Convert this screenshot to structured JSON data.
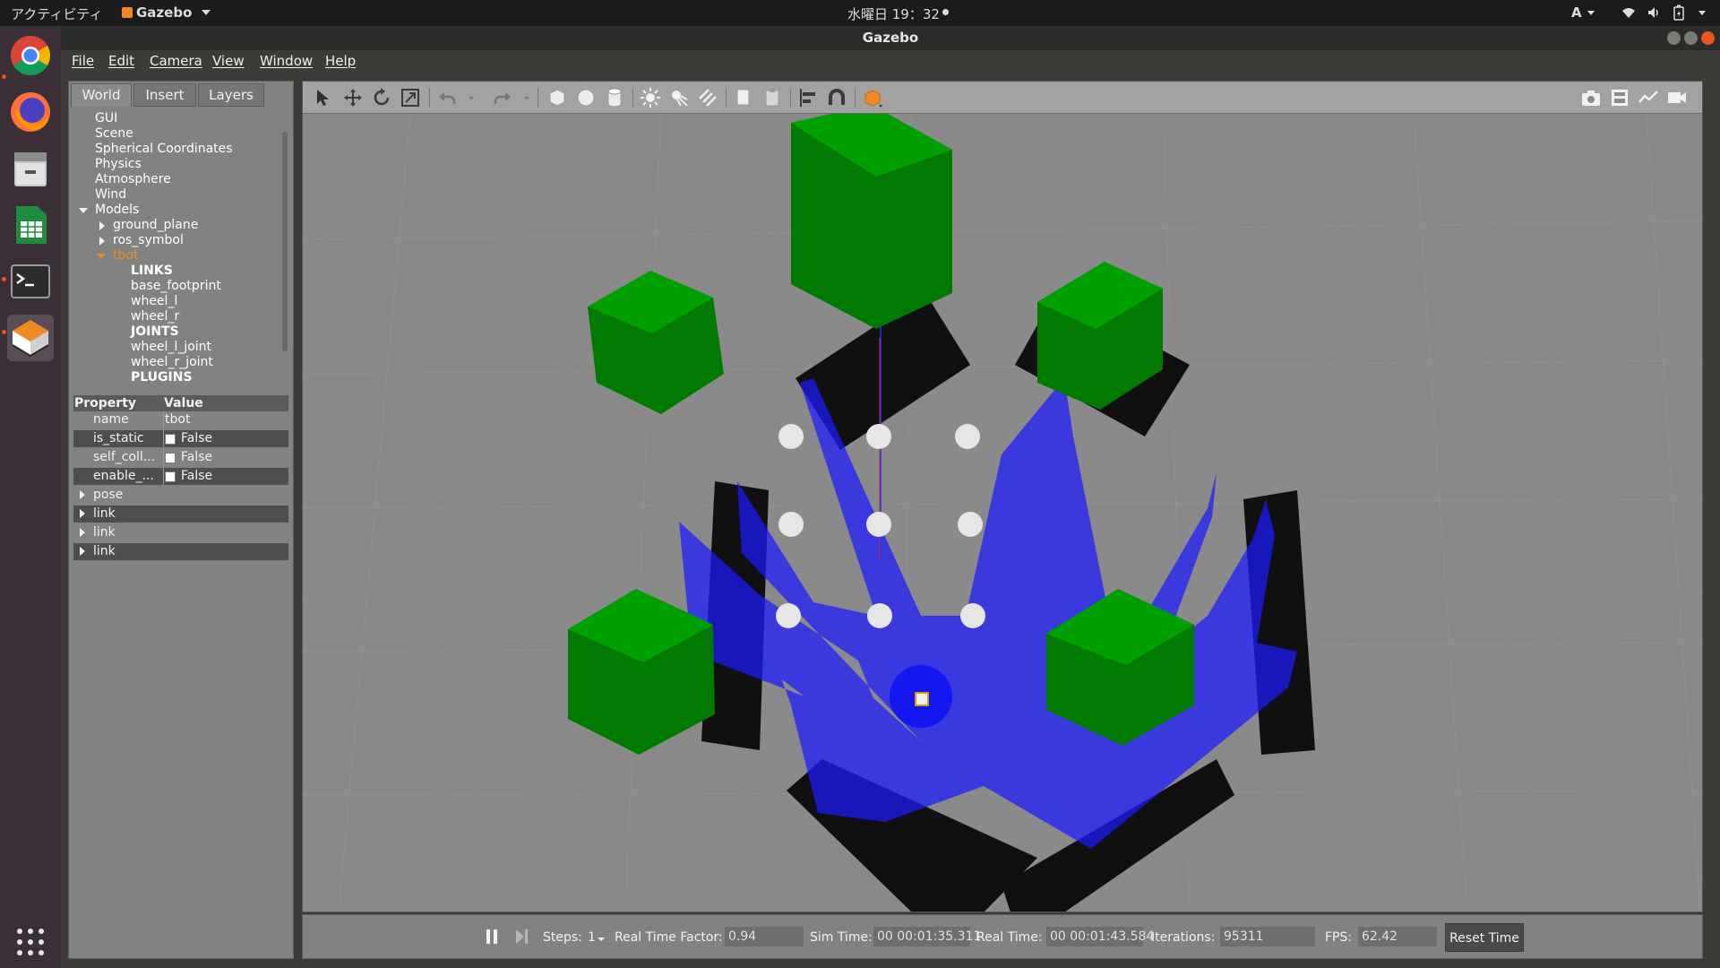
{
  "topbar": {
    "activities": "アクティビティ",
    "app_menu": "Gazebo",
    "clock": "水曜日 19：32",
    "input_method": "A"
  },
  "window": {
    "title": "Gazebo"
  },
  "menu": [
    "File",
    "Edit",
    "Camera",
    "View",
    "Window",
    "Help"
  ],
  "tabs": [
    "World",
    "Insert",
    "Layers"
  ],
  "tree": {
    "root_items": [
      "GUI",
      "Scene",
      "Spherical Coordinates",
      "Physics",
      "Atmosphere",
      "Wind"
    ],
    "models_label": "Models",
    "models": [
      "ground_plane",
      "ros_symbol"
    ],
    "selected_model": "tbot",
    "links_header": "LINKS",
    "links": [
      "base_footprint",
      "wheel_l",
      "wheel_r"
    ],
    "joints_header": "JOINTS",
    "joints": [
      "wheel_l_joint",
      "wheel_r_joint"
    ],
    "plugins_header": "PLUGINS"
  },
  "properties": {
    "header_property": "Property",
    "header_value": "Value",
    "name_key": "name",
    "name_value": "tbot",
    "is_static_key": "is_static",
    "is_static_value": "False",
    "self_coll_key": "self_coll...",
    "self_coll_value": "False",
    "enable_key": "enable_...",
    "enable_value": "False",
    "pose": "pose",
    "links": [
      "link",
      "link",
      "link"
    ]
  },
  "status": {
    "steps_label": "Steps:",
    "steps_value": "1",
    "rtf_label": "Real Time Factor:",
    "rtf_value": "0.94",
    "sim_label": "Sim Time:",
    "sim_value": "00 00:01:35.311",
    "real_label": "Real Time:",
    "real_value": "00 00:01:43.584",
    "iter_label": "Iterations:",
    "iter_value": "95311",
    "fps_label": "FPS:",
    "fps_value": "62.42",
    "reset_label": "Reset Time"
  },
  "colors": {
    "ground": "#8a8a8a",
    "green": "#008a00",
    "black_wall": "#111111",
    "laser": "#1a1aff",
    "marker": "#e6e6e6",
    "selected": "#f08a24"
  }
}
